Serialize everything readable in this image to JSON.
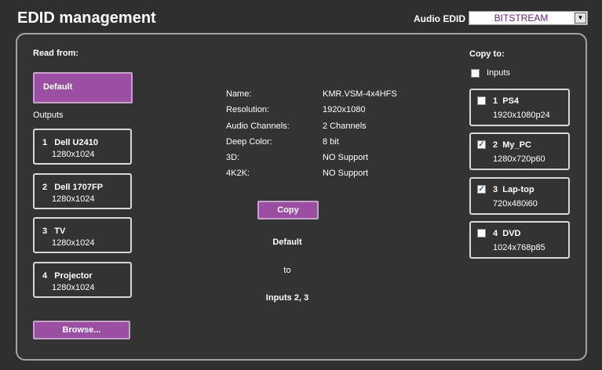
{
  "header": {
    "title": "EDID management",
    "audio_label": "Audio EDID",
    "audio_value": "BITSTREAM"
  },
  "read_from": {
    "label": "Read from:",
    "default_button": "Default",
    "outputs_label": "Outputs",
    "outputs": [
      {
        "num": "1",
        "name": "Dell U2410",
        "res": "1280x1024"
      },
      {
        "num": "2",
        "name": "Dell 1707FP",
        "res": "1280x1024"
      },
      {
        "num": "3",
        "name": "TV",
        "res": "1280x1024"
      },
      {
        "num": "4",
        "name": "Projector",
        "res": "1280x1024"
      }
    ],
    "browse_button": "Browse..."
  },
  "info": {
    "rows": [
      {
        "label": "Name:",
        "value": "KMR.VSM-4x4HFS"
      },
      {
        "label": "Resolution:",
        "value": "1920x1080"
      },
      {
        "label": "Audio Channels:",
        "value": "2 Channels"
      },
      {
        "label": "Deep Color:",
        "value": "8 bit"
      },
      {
        "label": "3D:",
        "value": "NO Support"
      },
      {
        "label": "4K2K:",
        "value": "NO Support"
      }
    ]
  },
  "copy": {
    "button": "Copy",
    "source": "Default",
    "to": "to",
    "target": "Inputs 2, 3"
  },
  "copy_to": {
    "label": "Copy to:",
    "inputs_label": "Inputs",
    "inputs_checked": false,
    "inputs": [
      {
        "num": "1",
        "name": "PS4",
        "res": "1920x1080p24",
        "checked": false
      },
      {
        "num": "2",
        "name": "My_PC",
        "res": "1280x720p60",
        "checked": true
      },
      {
        "num": "3",
        "name": "Lap-top",
        "res": "720x480i60",
        "checked": true
      },
      {
        "num": "4",
        "name": "DVD",
        "res": "1024x768p85",
        "checked": false
      }
    ]
  },
  "colors": {
    "accent": "#9b4fa3",
    "background": "#2f2f2f",
    "select_text": "#6a1b7a"
  }
}
